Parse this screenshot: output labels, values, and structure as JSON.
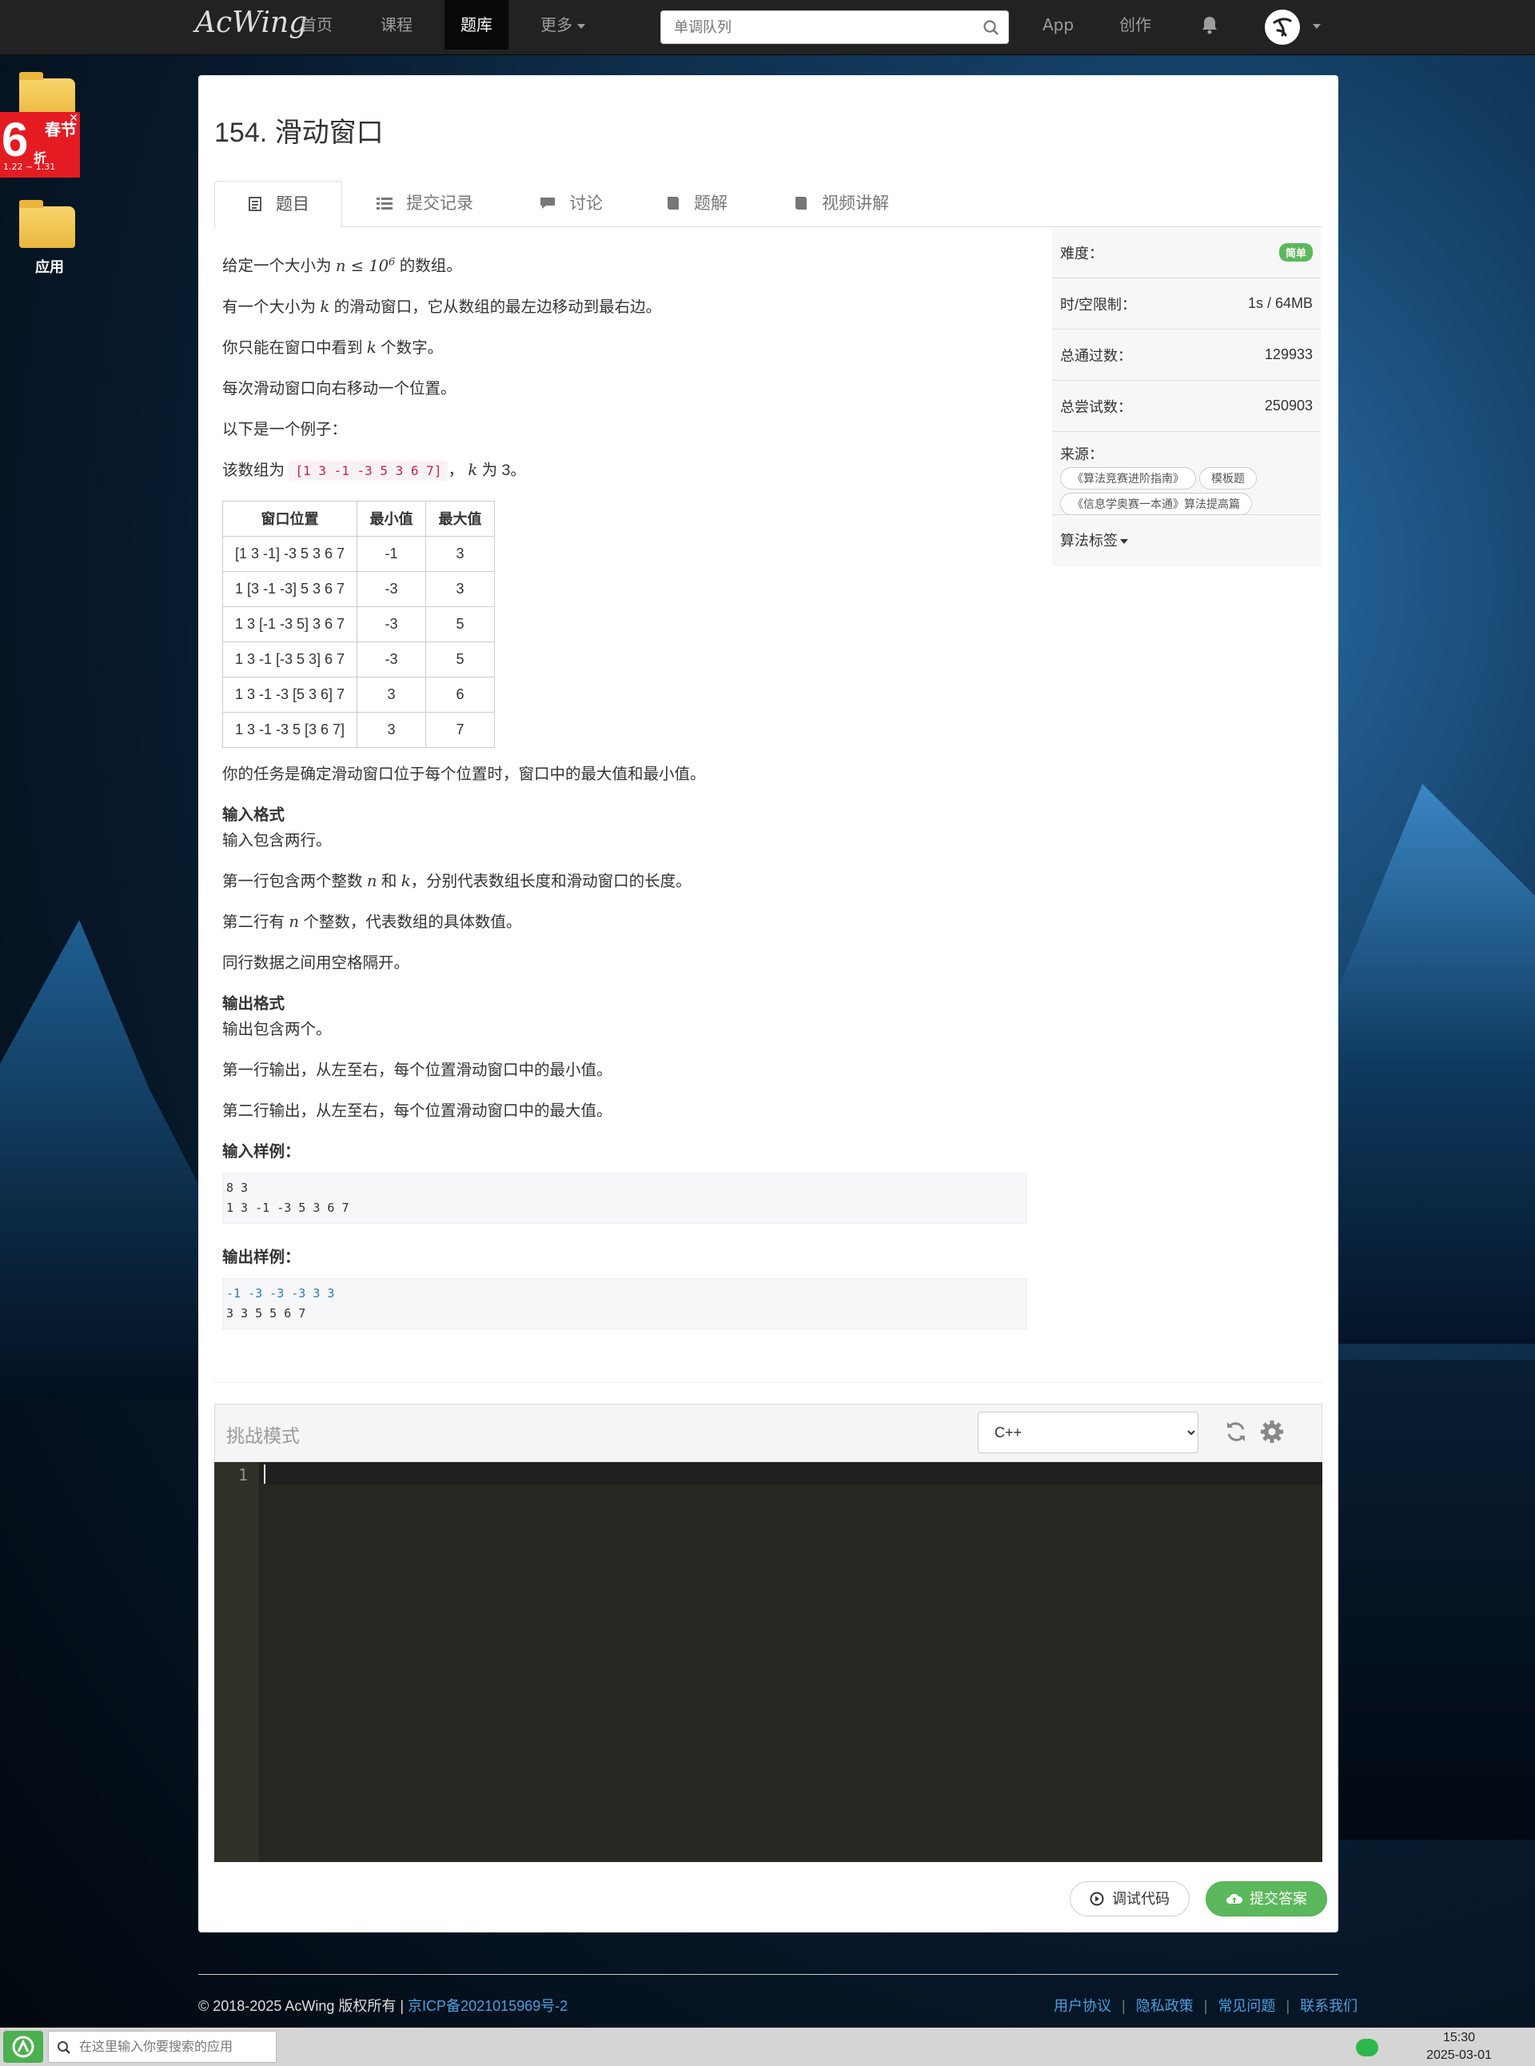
{
  "nav": {
    "logo": "AcWing",
    "items": [
      {
        "label": "首页"
      },
      {
        "label": "课程"
      },
      {
        "label": "题库"
      },
      {
        "label": "更多"
      }
    ],
    "search_placeholder": "单调队列",
    "app": "App",
    "create": "创作"
  },
  "desktop": {
    "promo_big": "6",
    "promo_line1": "春节",
    "promo_line2": "折",
    "promo_dates": "1.22 ~ 1.31",
    "app_label": "应用"
  },
  "problem": {
    "title": "154. 滑动窗口",
    "tabs": [
      {
        "label": "题目"
      },
      {
        "label": "提交记录"
      },
      {
        "label": "讨论"
      },
      {
        "label": "题解"
      },
      {
        "label": "视频讲解"
      }
    ],
    "p1a": "给定一个大小为 ",
    "p1math": "n ≤ 10",
    "p1sup": "6",
    "p1b": " 的数组。",
    "p2a": "有一个大小为 ",
    "p2b": " 的滑动窗口，它从数组的最左边移动到最右边。",
    "p3a": "你只能在窗口中看到 ",
    "p3b": " 个数字。",
    "p4": "每次滑动窗口向右移动一个位置。",
    "p5": "以下是一个例子：",
    "p6a": "该数组为 ",
    "p6code": "[1 3 -1 -3 5 3 6 7]",
    "p6b": "， ",
    "p6c": " 为 3。",
    "k": "k",
    "n": "n",
    "table_head": [
      "窗口位置",
      "最小值",
      "最大值"
    ],
    "table_rows": [
      [
        "[1 3 -1] -3 5 3 6 7",
        "-1",
        "3"
      ],
      [
        "1 [3 -1 -3] 5 3 6 7",
        "-3",
        "3"
      ],
      [
        "1 3 [-1 -3 5] 3 6 7",
        "-3",
        "5"
      ],
      [
        "1 3 -1 [-3 5 3] 6 7",
        "-3",
        "5"
      ],
      [
        "1 3 -1 -3 [5 3 6] 7",
        "3",
        "6"
      ],
      [
        "1 3 -1 -3 5 [3 6 7]",
        "3",
        "7"
      ]
    ],
    "task": "你的任务是确定滑动窗口位于每个位置时，窗口中的最大值和最小值。",
    "input_h": "输入格式",
    "in1": "输入包含两行。",
    "in2a": "第一行包含两个整数 ",
    "in2b": " 和 ",
    "in2c": "，分别代表数组长度和滑动窗口的长度。",
    "in3a": "第二行有 ",
    "in3b": " 个整数，代表数组的具体数值。",
    "in4": "同行数据之间用空格隔开。",
    "output_h": "输出格式",
    "out1": "输出包含两个。",
    "out2": "第一行输出，从左至右，每个位置滑动窗口中的最小值。",
    "out3": "第二行输出，从左至右，每个位置滑动窗口中的最大值。",
    "sample_in_h": "输入样例：",
    "sample_in_1": "8 3",
    "sample_in_2": "1 3 -1 -3 5 3 6 7",
    "sample_out_h": "输出样例：",
    "sample_out_1": "-1 -3 -3 -3 3 3",
    "sample_out_2": "3 3 5 5 6 7"
  },
  "side": {
    "difficulty_label": "难度：",
    "difficulty": "简单",
    "limit_label": "时/空限制：",
    "limit": "1s / 64MB",
    "passed_label": "总通过数：",
    "passed": "129933",
    "tried_label": "总尝试数：",
    "tried": "250903",
    "source_label": "来源：",
    "sources": [
      "《算法竞赛进阶指南》",
      "模板题",
      "《信息学奥赛一本通》算法提高篇"
    ],
    "algo_tags": "算法标签"
  },
  "editor": {
    "mode": "挑战模式",
    "language": "C++",
    "line1": "1",
    "debug": "调试代码",
    "submit": "提交答案"
  },
  "footer": {
    "copyright": "© 2018-2025 AcWing 版权所有  |  ",
    "icp": "京ICP备2021015969号-2",
    "links": [
      "用户协议",
      "隐私政策",
      "常见问题",
      "联系我们"
    ]
  },
  "taskbar": {
    "search_placeholder": "在这里输入你要搜索的应用",
    "time": "15:30",
    "date": "2025-03-01"
  }
}
